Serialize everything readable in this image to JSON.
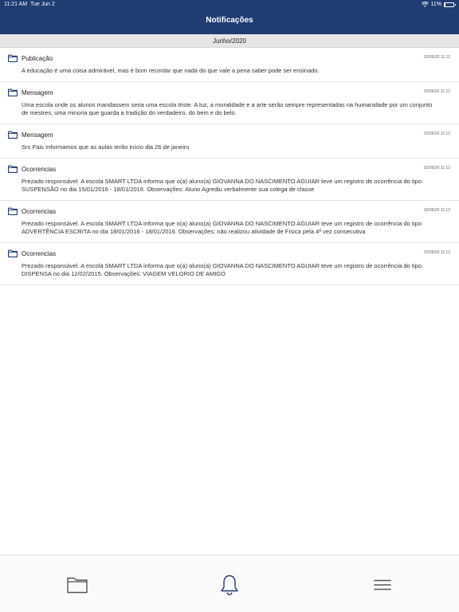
{
  "status_bar": {
    "time": "11:21 AM",
    "date": "Tue Jun 2",
    "battery_text": "11%",
    "battery_level": 0.11,
    "wifi_icon": "wifi-icon"
  },
  "header": {
    "title": "Notificações"
  },
  "section": {
    "month": "Junho/2020"
  },
  "notifications": [
    {
      "category": "Publicação",
      "timestamp": "02/06/20 11:12",
      "message": "A educação é uma coisa admirável, mas é bom recordar que nada do que vale a pena saber pode ser ensinado."
    },
    {
      "category": "Mensagem",
      "timestamp": "02/06/20 11:12",
      "message": "Uma escola onde os alunos mandassem seria uma escola triste. A luz, a moralidade e a arte serão sempre representadas na humanidade por um conjunto de mestres, uma minoria que guarda a tradição do verdadeiro, do bem e do belo."
    },
    {
      "category": "Mensagem",
      "timestamp": "02/06/20 11:12",
      "message": "Srs Pais Informamos que as aulas terão início dia 26 de janeiro"
    },
    {
      "category": "Ocorrencias",
      "timestamp": "02/06/20 11:12",
      "message": "Prezado responsável. A escola SMART LTDA informa que o(a) aluno(a) GIOVANNA DO NASCIMENTO AGUIAR teve um registro de ocorrência do tipo SUSPENSÃO no dia 15/01/2016 - 18/01/2016. Observações: Aluno Agrediu verbalmente sua colega de classe"
    },
    {
      "category": "Ocorrencias",
      "timestamp": "02/06/20 11:12",
      "message": "Prezado responsável. A escola SMART LTDA informa que o(a) aluno(a) GIOVANNA DO NASCIMENTO AGUIAR teve um registro de ocorrência do tipo ADVERTÊNCIA ESCRITA no dia 18/01/2016 - 18/01/2016. Observações: não realizou atividade de Física pela 4ª vez consecutiva"
    },
    {
      "category": "Ocorrencias",
      "timestamp": "02/06/20 11:12",
      "message": "Prezado responsável. A escola SMART LTDA informa que o(a) aluno(a) GIOVANNA DO NASCIMENTO AGUIAR teve um registro de ocorrência do tipo DISPENSA no dia 12/02/2015. Observações: VIAGEM VELORIO DE AMIGO"
    }
  ],
  "tab_bar": {
    "tabs": [
      {
        "icon": "folder-icon"
      },
      {
        "icon": "bell-icon"
      },
      {
        "icon": "menu-icon"
      }
    ]
  },
  "colors": {
    "header_bg": "#1f3c73",
    "section_bg": "#e6e6e6",
    "tab_icon": "#555555"
  }
}
